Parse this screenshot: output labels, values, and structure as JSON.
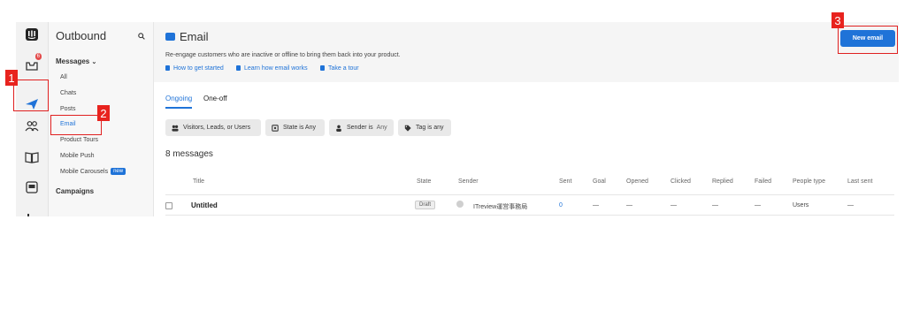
{
  "rail": {
    "inbox_badge": "6"
  },
  "subnav": {
    "title": "Outbound",
    "messages_label": "Messages",
    "items": [
      {
        "label": "All"
      },
      {
        "label": "Chats"
      },
      {
        "label": "Posts"
      },
      {
        "label": "Email"
      },
      {
        "label": "Product Tours"
      },
      {
        "label": "Mobile Push"
      },
      {
        "label": "Mobile Carousels",
        "badge": "new"
      }
    ],
    "campaigns_label": "Campaigns"
  },
  "header": {
    "title": "Email",
    "description": "Re-engage customers who are inactive or offline to bring them back into your product.",
    "links": [
      "How to get started",
      "Learn how email works",
      "Take a tour"
    ],
    "new_button": "New email"
  },
  "tabs": [
    "Ongoing",
    "One-off"
  ],
  "filters": {
    "audience": "Visitors, Leads, or Users",
    "state": "State is Any",
    "sender_prefix": "Sender is",
    "sender_value": "Any",
    "tag": "Tag is any"
  },
  "count_text": "8 messages",
  "table": {
    "columns": [
      "Title",
      "State",
      "Sender",
      "Sent",
      "Goal",
      "Opened",
      "Clicked",
      "Replied",
      "Failed",
      "People type",
      "Last sent"
    ],
    "rows": [
      {
        "title": "Untitled",
        "state": "Draft",
        "sender": "ITreview運営事務局",
        "sent": "0",
        "goal": "—",
        "opened": "—",
        "clicked": "—",
        "replied": "—",
        "failed": "—",
        "people_type": "Users",
        "last_sent": "—"
      }
    ]
  },
  "callouts": [
    "1",
    "2",
    "3"
  ],
  "colors": {
    "accent": "#1f73d8",
    "callout": "#e8231e"
  }
}
